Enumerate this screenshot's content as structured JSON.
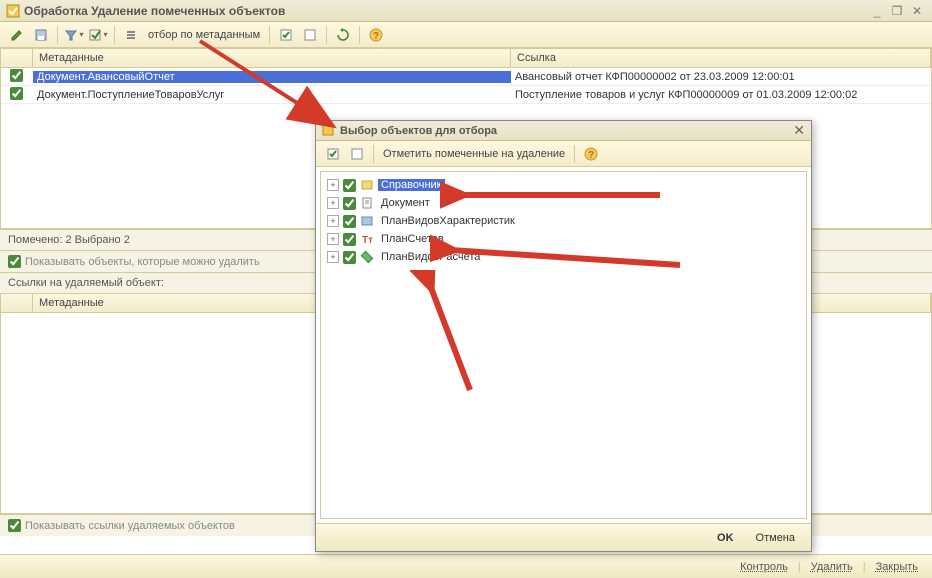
{
  "window": {
    "title": "Обработка  Удаление помеченных объектов",
    "minimize": "_",
    "restore": "❐",
    "close": "✕"
  },
  "toolbar": {
    "filter_text": "отбор по метаданным"
  },
  "grid": {
    "headers": {
      "metadata": "Метаданные",
      "link": "Ссылка"
    },
    "rows": [
      {
        "checked": true,
        "metadata": "Документ.АвансовыйОтчет",
        "link": "Авансовый отчет КФП00000002 от 23.03.2009 12:00:01",
        "selected": true
      },
      {
        "checked": true,
        "metadata": "Документ.ПоступлениеТоваровУслуг",
        "link": "Поступление товаров и услуг КФП00000009 от 01.03.2009 12:00:02",
        "selected": false
      }
    ]
  },
  "status": {
    "marked": "Помечено: 2  Выбрано 2",
    "show_deletable": "Показывать объекты, которые можно удалить"
  },
  "links_section": {
    "label": "Ссылки на удаляемый объект:",
    "header": "Метаданные"
  },
  "show_links": "Показывать ссылки удаляемых объектов",
  "bottom": {
    "control": "Контроль",
    "delete": "Удалить",
    "close": "Закрыть"
  },
  "modal": {
    "title": "Выбор объектов для отбора",
    "toolbar_text": "Отметить помеченные на удаление",
    "ok": "OK",
    "cancel": "Отмена",
    "items": [
      {
        "label": "Справочник",
        "selected": true
      },
      {
        "label": "Документ",
        "selected": false
      },
      {
        "label": "ПланВидовХарактеристик",
        "selected": false
      },
      {
        "label": "ПланСчетов",
        "selected": false
      },
      {
        "label": "ПланВидовРасчета",
        "selected": false
      }
    ]
  }
}
